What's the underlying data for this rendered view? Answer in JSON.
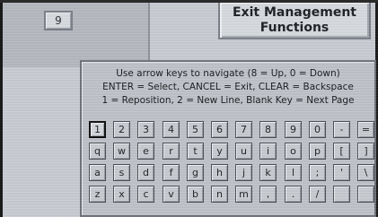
{
  "background": {
    "number_button_label": "9",
    "exit_button_label_line1": "Exit Management",
    "exit_button_label_line2": "Functions"
  },
  "dialog": {
    "instruction_lines": [
      "Use arrow keys to navigate (8 = Up, 0 = Down)",
      "ENTER = Select, CANCEL = Exit, CLEAR = Backspace",
      "1 = Reposition, 2 = New Line, Blank Key = Next Page"
    ],
    "keyboard_rows": [
      [
        "1",
        "2",
        "3",
        "4",
        "5",
        "6",
        "7",
        "8",
        "9",
        "0",
        "-",
        "="
      ],
      [
        "q",
        "w",
        "e",
        "r",
        "t",
        "y",
        "u",
        "i",
        "o",
        "p",
        "[",
        "]"
      ],
      [
        "a",
        "s",
        "d",
        "f",
        "g",
        "h",
        "j",
        "k",
        "l",
        ";",
        "'",
        "\\"
      ],
      [
        "z",
        "x",
        "c",
        "v",
        "b",
        "n",
        "m",
        ",",
        ".",
        "/",
        "",
        ""
      ]
    ],
    "active_key": "1"
  }
}
